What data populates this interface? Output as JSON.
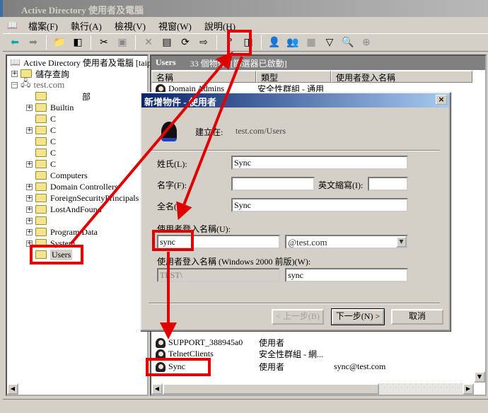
{
  "window": {
    "title": "Active Directory 使用者及電腦"
  },
  "menu": [
    "檔案(F)",
    "執行(A)",
    "檢視(V)",
    "視窗(W)",
    "說明(H)"
  ],
  "toolbar": [
    "back-icon",
    "forward-icon",
    "up-folder-icon",
    "show-tree-icon",
    "cut-icon",
    "paste-icon",
    "delete-icon",
    "properties-icon",
    "refresh-icon",
    "export-icon",
    "help-icon",
    "console-tree-icon",
    "new-user-icon",
    "new-group-icon",
    "new-ou-icon",
    "filter-icon",
    "find-icon",
    "add-to-group-icon"
  ],
  "tree": {
    "root": "Active Directory 使用者及電腦 [taip",
    "items": [
      {
        "label": "儲存查詢"
      },
      {
        "label": "test.com"
      },
      {
        "label": "部"
      },
      {
        "label": "Builtin"
      },
      {
        "label": "C"
      },
      {
        "label": "C"
      },
      {
        "label": "C"
      },
      {
        "label": "C"
      },
      {
        "label": "C"
      },
      {
        "label": "Computers"
      },
      {
        "label": "Domain Controllers"
      },
      {
        "label": "ForeignSecurityPrincipals"
      },
      {
        "label": "LostAndFound"
      },
      {
        "label": ""
      },
      {
        "label": "Program Data"
      },
      {
        "label": "System"
      },
      {
        "label": "Users"
      }
    ]
  },
  "list": {
    "header_title": "Users",
    "count": "33 個物件",
    "filter": "[篩選器已啟動]",
    "columns": [
      "名稱",
      "類型",
      "使用者登入名稱"
    ],
    "rows": [
      {
        "name": "Domain Admins",
        "type": "安全性群組 - 通用",
        "login": ""
      },
      {
        "name": "SUPPORT_388945a0",
        "type": "使用者",
        "login": ""
      },
      {
        "name": "TelnetClients",
        "type": "安全性群組 - 網...",
        "login": ""
      },
      {
        "name": "Sync",
        "type": "使用者",
        "login": "sync@test.com"
      }
    ]
  },
  "dialog": {
    "title": "新增物件 - 使用者",
    "close": "×",
    "create_in_label": "建立在:",
    "create_in_value": "test.com/Users",
    "last_name_label": "姓氏(L):",
    "last_name": "Sync",
    "first_name_label": "名字(F):",
    "first_name": "",
    "initials_label": "英文縮寫(I):",
    "initials": "",
    "full_name_label": "全名(A):",
    "full_name": "Sync",
    "logon_label": "使用者登入名稱(U):",
    "logon": "sync",
    "domain": "@test.com",
    "pre2000_label": "使用者登入名稱 (Windows 2000 前版)(W):",
    "pre2000_domain": "TEST\\",
    "pre2000_name": "sync",
    "back": "< 上一步(B)",
    "next": "下一步(N) >",
    "cancel": "取消"
  },
  "colors": {
    "annotation": "#e00000",
    "title_active": "#0a246a"
  }
}
